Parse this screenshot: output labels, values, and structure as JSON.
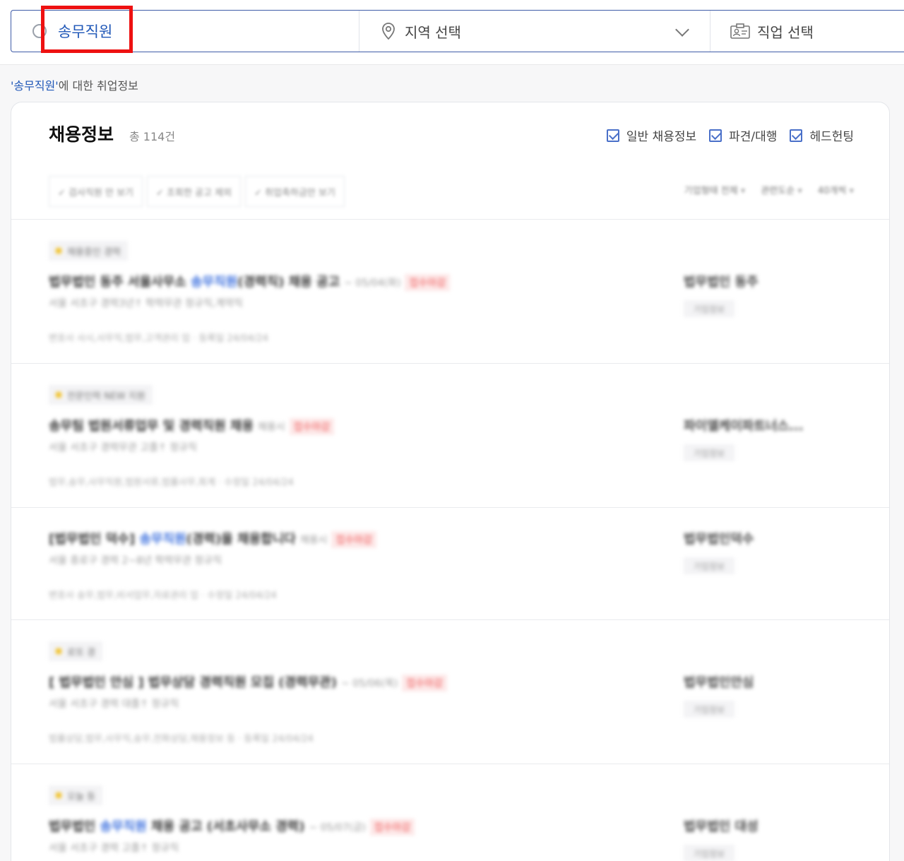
{
  "search": {
    "keyword": "송무직원",
    "region_label": "지역 선택",
    "job_label": "직업 선택"
  },
  "caption": {
    "keyword": "'송무직원'",
    "suffix": "에 대한 취업정보"
  },
  "panel": {
    "title": "채용정보",
    "count": "총 114건",
    "types": [
      "일반 채용정보",
      "파견/대행",
      "헤드헌팅"
    ],
    "filters": [
      "✓ 검사직원 만 보기",
      "✓ 조회한 공고 제외",
      "✓ 취업축하금만 보기"
    ],
    "sorts": [
      "기업형태 전체",
      "관련도순",
      "40개씩"
    ]
  },
  "listings": [
    {
      "tag": "채용중인 경력",
      "title_pre": "법무법인 동주 서울사무소 ",
      "title_kw": "송무직원",
      "title_post": "(경력직) 채용 공고",
      "meta": "~ 05/04(화)",
      "urgent": "접수마감",
      "details": "서울 서초구   경력3년↑   학력무관   정규직,계약직",
      "sector": "변호사 사시,사무직,법무,고객관리 업 · 등록일 24/04/24",
      "company": "법무법인 동주",
      "badge": "기업정보"
    },
    {
      "tag": "전문인력 NEW 지원",
      "title_pre": "송무팀 법원서류업무 및 경력직원 채용",
      "title_kw": "",
      "title_post": "",
      "meta": "채용시",
      "urgent": "접수마감",
      "details": "서울 서초구   경력무관   고졸↑   정규직",
      "sector": "법무,송무,사무직원,법원서류,법률사무,회계 · 수정일 24/04/24",
      "company": "파이엘케이파트너스...",
      "badge": "기업정보"
    },
    {
      "tag": "",
      "title_pre": "[법무법인 덕수] ",
      "title_kw": "송무직원",
      "title_post": "(경력)을 채용합니다",
      "meta": "채용시",
      "urgent": "접수마감",
      "details": "서울 종로구   경력 2~8년   학력무관   정규직",
      "sector": "변호사 송무,법무,비서업무,자료관리 업 · 수정일 24/04/24",
      "company": "법무법인덕수",
      "badge": "기업정보"
    },
    {
      "tag": "로또 경",
      "title_pre": "[ 법무법인 안심 ] 법무상담 경력직원 모집 (경력무관)",
      "title_kw": "",
      "title_post": "",
      "meta": "~ 05/06(목)",
      "urgent": "접수마감",
      "details": "서울 서초구   경력   대졸↑   정규직",
      "sector": "법률상담,법무,사무직,송무,전화상담,채용정보 등 · 등록일 24/04/24",
      "company": "법무법인안심",
      "badge": "기업정보"
    },
    {
      "tag": "오늘 등",
      "title_pre": "법무법인 ",
      "title_kw": "송무직원",
      "title_post": " 채용 공고 (서초사무소 경력)",
      "meta": "~ 05/07(금)",
      "urgent": "접수마감",
      "details": "서울 서초구   경력   고졸↑   정규직",
      "sector": "",
      "company": "법무법인 대성",
      "badge": "기업정보"
    }
  ]
}
